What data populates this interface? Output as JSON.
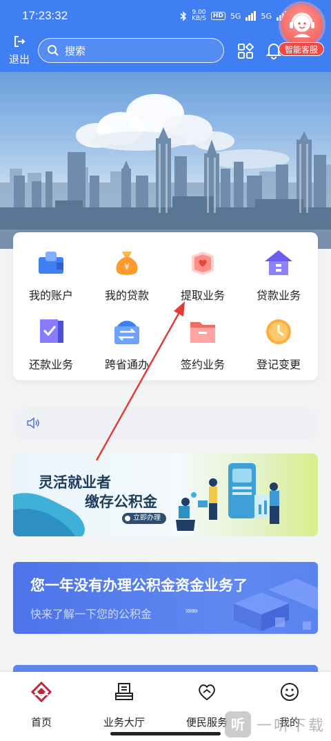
{
  "status_bar": {
    "time": "17:23:32",
    "speed_value": "9.00",
    "speed_unit": "KB/S",
    "hd_badge": "HD",
    "network_1": "5G",
    "network_2": "5G",
    "battery": "77"
  },
  "header": {
    "logout_label": "退出",
    "search_placeholder": "搜索",
    "customer_service_label": "智能客服",
    "icons": {
      "logout": "logout-icon",
      "search": "search-icon",
      "apps": "apps-grid-icon",
      "bell": "bell-icon",
      "service": "customer-service-avatar-icon"
    }
  },
  "services": {
    "items": [
      {
        "label": "我的账户",
        "icon": "account-icon"
      },
      {
        "label": "我的贷款",
        "icon": "money-bag-icon"
      },
      {
        "label": "提取业务",
        "icon": "withdraw-heart-icon"
      },
      {
        "label": "贷款业务",
        "icon": "house-loan-icon"
      },
      {
        "label": "还款业务",
        "icon": "repay-check-icon"
      },
      {
        "label": "跨省通办",
        "icon": "transfer-arrows-icon"
      },
      {
        "label": "签约业务",
        "icon": "folder-contract-icon"
      },
      {
        "label": "登记变更",
        "icon": "clock-change-icon"
      }
    ]
  },
  "notice": {
    "icon": "speaker-icon",
    "text": ""
  },
  "promo_1": {
    "line_1": "灵活就业者",
    "line_2": "缴存公积金",
    "button": "立即办理"
  },
  "promo_2": {
    "title": "您一年没有办理公积金资金业务了",
    "subtitle": "快来了解一下您的公积金",
    "arrows": "»»»"
  },
  "bottom_nav": {
    "items": [
      {
        "label": "首页",
        "icon": "home-logo-icon"
      },
      {
        "label": "业务大厅",
        "icon": "business-hall-icon"
      },
      {
        "label": "便民服务",
        "icon": "heart-hand-icon"
      },
      {
        "label": "我的",
        "icon": "smile-face-icon"
      }
    ]
  },
  "watermark": {
    "badge": "听",
    "text": "一听下载"
  },
  "colors": {
    "primary": "#3f7ef3",
    "service_red": "#f04a46",
    "annotation_arrow": "#e53935",
    "promo_blue": "#4d73ea",
    "home_red": "#c8213b"
  }
}
